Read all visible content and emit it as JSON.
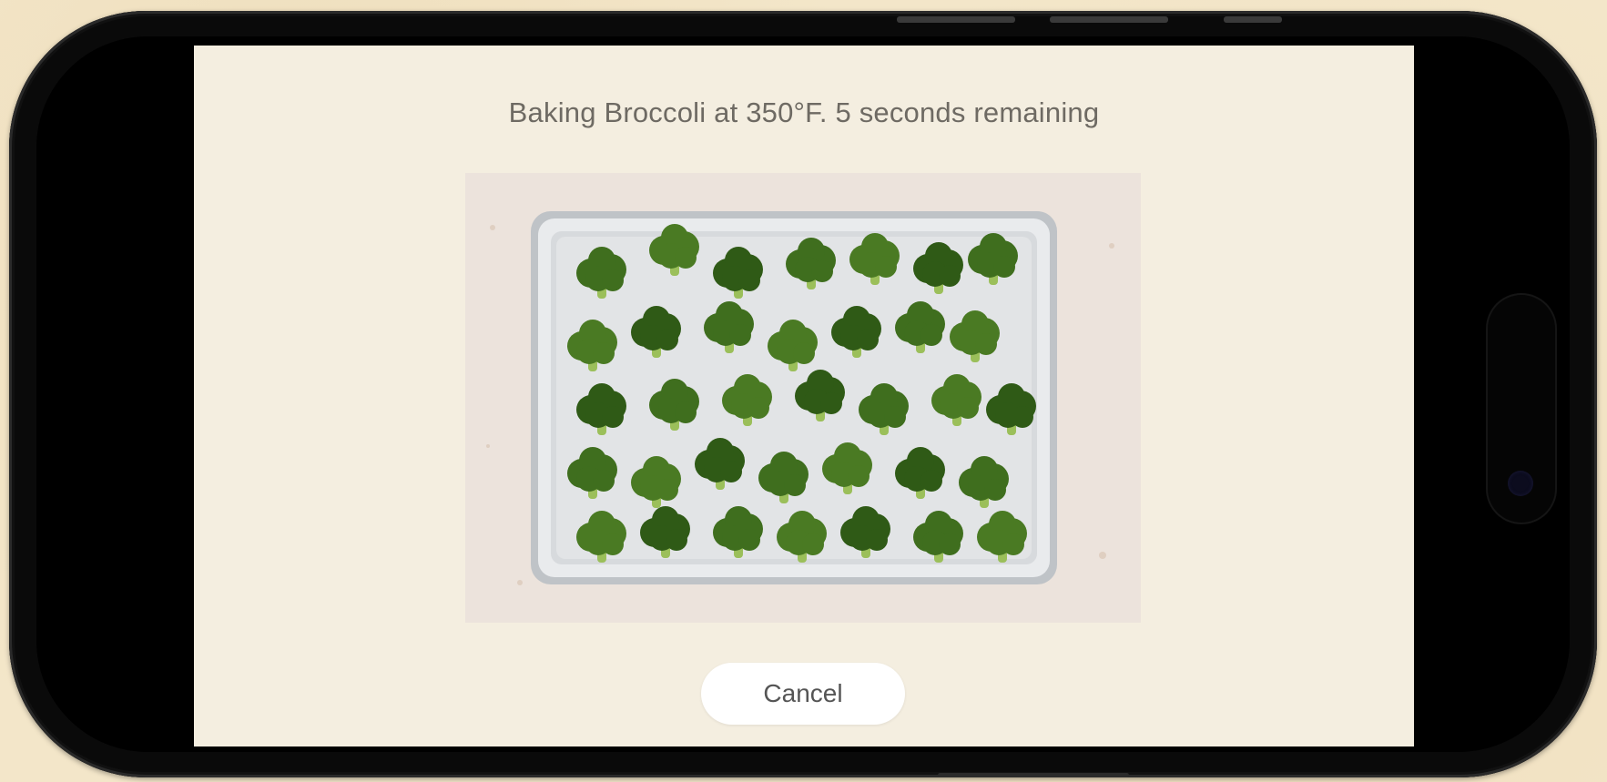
{
  "screen": {
    "status_text": "Baking Broccoli at 350°F. 5 seconds remaining",
    "image": {
      "subject": "broccoli florets on baking sheet",
      "icon": "broccoli-photo"
    },
    "cancel_label": "Cancel"
  },
  "colors": {
    "background": "#f3e6c9",
    "screen_bg": "#f4eee0",
    "title_text": "#6e6a63",
    "button_bg": "#ffffff",
    "broccoli": "#4a7a23"
  }
}
